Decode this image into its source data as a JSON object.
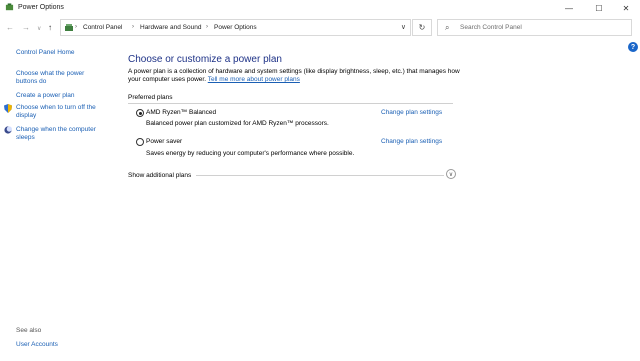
{
  "window": {
    "title": "Power Options",
    "controls": {
      "minimize": "—",
      "maximize": "☐",
      "close": "✕"
    }
  },
  "nav": {
    "back": "←",
    "forward": "→",
    "recent": "∨",
    "up": "↑",
    "refresh": "↻",
    "dropdown": "∨",
    "breadcrumbs": [
      "Control Panel",
      "Hardware and Sound",
      "Power Options"
    ],
    "separator": "›"
  },
  "search": {
    "placeholder": "Search Control Panel",
    "value": ""
  },
  "help_label": "?",
  "sidebar": {
    "home": "Control Panel Home",
    "items": [
      {
        "label": "Choose what the power buttons do"
      },
      {
        "label": "Create a power plan"
      },
      {
        "label": "Choose when to turn off the display",
        "icon": "shield-icon"
      },
      {
        "label": "Change when the computer sleeps",
        "icon": "moon-icon"
      }
    ],
    "see_also": "See also",
    "user_accounts": "User Accounts"
  },
  "main": {
    "title": "Choose or customize a power plan",
    "description": "A power plan is a collection of hardware and system settings (like display brightness, sleep, etc.) that manages how your computer uses power.",
    "learn_more": "Tell me more about power plans",
    "preferred_label": "Preferred plans",
    "plans": [
      {
        "name": "AMD Ryzen™ Balanced",
        "description": "Balanced power plan customized for AMD Ryzen™ processors.",
        "selected": true,
        "link": "Change plan settings"
      },
      {
        "name": "Power saver",
        "description": "Saves energy by reducing your computer's performance where possible.",
        "selected": false,
        "link": "Change plan settings"
      }
    ],
    "show_additional": "Show additional plans",
    "expander": "∨"
  }
}
